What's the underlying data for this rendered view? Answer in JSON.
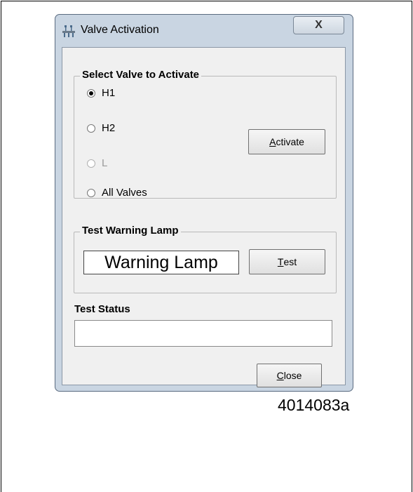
{
  "window": {
    "title": "Valve Activation",
    "title_icon": "valve-app-icon",
    "close_glyph": "X"
  },
  "select_group": {
    "legend": "Select Valve to Activate",
    "options": [
      {
        "label": "H1",
        "selected": true,
        "enabled": true
      },
      {
        "label": "H2",
        "selected": false,
        "enabled": true
      },
      {
        "label": "L",
        "selected": false,
        "enabled": false
      },
      {
        "label": "All Valves",
        "selected": false,
        "enabled": true
      }
    ],
    "activate_button": {
      "mnemonic": "A",
      "rest": "ctivate"
    }
  },
  "warning_group": {
    "legend": "Test Warning Lamp",
    "lamp_text": "Warning Lamp",
    "test_button": {
      "mnemonic": "T",
      "rest": "est"
    }
  },
  "status": {
    "label": "Test Status",
    "value": ""
  },
  "close_button": {
    "mnemonic": "C",
    "rest": "lose"
  },
  "figure_id": "4014083a"
}
